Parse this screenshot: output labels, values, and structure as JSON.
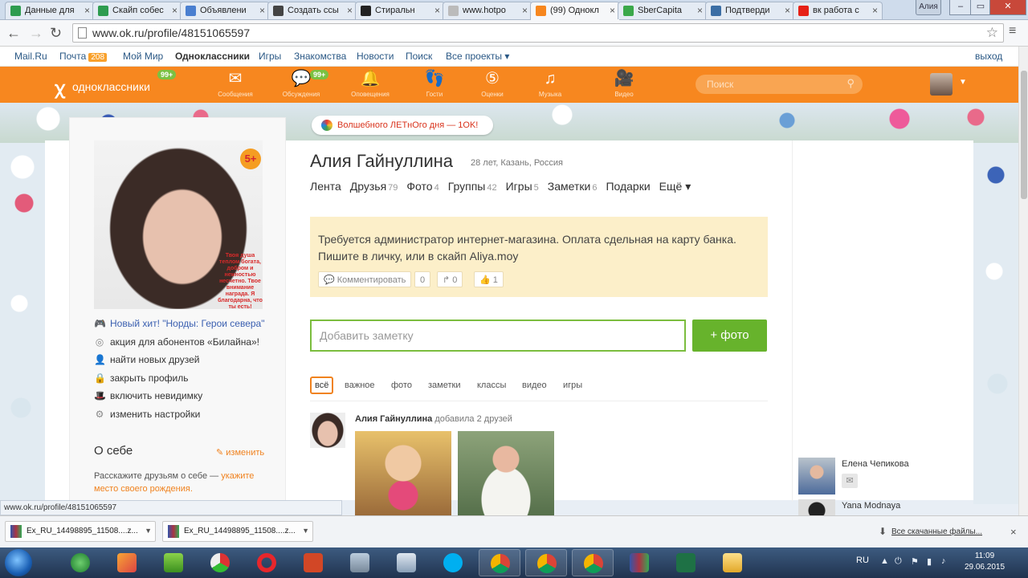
{
  "browser": {
    "tabs": [
      {
        "label": "Данные для",
        "color": "#2e9c4f",
        "active": false
      },
      {
        "label": "Скайп собес",
        "color": "#2e9c4f",
        "active": false
      },
      {
        "label": "Объявлени",
        "color": "#4a7fd0",
        "active": false
      },
      {
        "label": "Создать ссы",
        "color": "#444444",
        "active": false
      },
      {
        "label": "Стиральн",
        "color": "#222222",
        "active": false
      },
      {
        "label": "www.hotpo",
        "color": "#bbbbbb",
        "active": false
      },
      {
        "label": "(99) Однокл",
        "color": "#f7871f",
        "active": true
      },
      {
        "label": "SberCapita",
        "color": "#3aa84a",
        "active": false
      },
      {
        "label": "Подтверди",
        "color": "#3b6ea5",
        "active": false
      },
      {
        "label": "вк работа с",
        "color": "#e62117",
        "active": false
      }
    ],
    "user_badge": "Алия",
    "url": "www.ok.ru/profile/48151065597"
  },
  "portal": {
    "links": [
      "Mail.Ru",
      "Почта",
      "Мой Мир",
      "Одноклассники",
      "Игры",
      "Знакомства",
      "Новости",
      "Поиск",
      "Все проекты ▾"
    ],
    "mail_badge": "208",
    "logout": "выход"
  },
  "header": {
    "logo_glyph": "ꭓ",
    "logo_text": "одноклассники",
    "logo_badge": "99+",
    "nav": [
      {
        "icon": "✉",
        "label": "Сообщения"
      },
      {
        "icon": "💬",
        "label": "Обсуждения",
        "badge": "99+"
      },
      {
        "icon": "🔔",
        "label": "Оповещения"
      },
      {
        "icon": "👣",
        "label": "Гости"
      },
      {
        "icon": "⑤",
        "label": "Оценки"
      },
      {
        "icon": "♫",
        "label": "Музыка"
      },
      {
        "icon": "🎥",
        "label": "Видео"
      }
    ],
    "search_placeholder": "Поиск",
    "search_icon": "⚲"
  },
  "banner_pill": "Волшебного ЛЕТнОго дня — 1OK!",
  "profile": {
    "age_badge": "5+",
    "photo_caption": "Твоя душа теплом богата, добром и нежностью несчетно. Твое внимание награда. Я благодарна, что ты есть!",
    "name": "Алия Гайнуллина",
    "meta": "28 лет, Казань, Россия",
    "tabs": [
      {
        "label": "Лента",
        "count": ""
      },
      {
        "label": "Друзья",
        "count": "79"
      },
      {
        "label": "Фото",
        "count": "4"
      },
      {
        "label": "Группы",
        "count": "42"
      },
      {
        "label": "Игры",
        "count": "5"
      },
      {
        "label": "Заметки",
        "count": "6"
      },
      {
        "label": "Подарки",
        "count": ""
      },
      {
        "label": "Ещё ▾",
        "count": ""
      }
    ]
  },
  "sidebar": {
    "items": [
      {
        "icon": "🎮",
        "label": "Новый хит! \"Норды: Герои севера\"",
        "highlight": true
      },
      {
        "icon": "◎",
        "label": "акция для абонентов «Билайна»!",
        "highlight": false
      },
      {
        "icon": "👤",
        "label": "найти новых друзей",
        "highlight": false
      },
      {
        "icon": "🔒",
        "label": "закрыть профиль",
        "highlight": false
      },
      {
        "icon": "🎩",
        "label": "включить невидимку",
        "highlight": false
      },
      {
        "icon": "⚙",
        "label": "изменить настройки",
        "highlight": false
      }
    ],
    "about_title": "О себе",
    "about_edit": "✎ изменить",
    "about_text": "Расскажите друзьям о себе — ",
    "about_link": "укажите место своего рождения."
  },
  "status": {
    "text": "Требуется администратор интернет-магазина. Оплата сдельная на карту банка. Пишите в личку, или в скайп Aliya.moy",
    "comment_label": "Комментировать",
    "comment_count": "0",
    "reshare_count": "0",
    "like_count": "1"
  },
  "note_input": {
    "placeholder": "Добавить заметку"
  },
  "photo_button": "+ фото",
  "feed": {
    "filters": [
      "всё",
      "важное",
      "фото",
      "заметки",
      "классы",
      "видео",
      "игры"
    ],
    "active_filter": "всё",
    "item_author": "Алия Гайнуллина",
    "item_action": " добавила 2 друзей"
  },
  "friends": [
    {
      "name": "Елена Чепикова"
    },
    {
      "name": "Yana Modnaya"
    }
  ],
  "status_url": "www.ok.ru/profile/48151065597",
  "downloads": {
    "items": [
      "Ex_RU_14498895_11508....z...",
      "Ex_RU_14498895_11508....z..."
    ],
    "show_all": "Все скачанные файлы...",
    "close": "×"
  },
  "taskbar": {
    "lang": "RU",
    "time": "11:09",
    "date": "29.06.2015"
  }
}
